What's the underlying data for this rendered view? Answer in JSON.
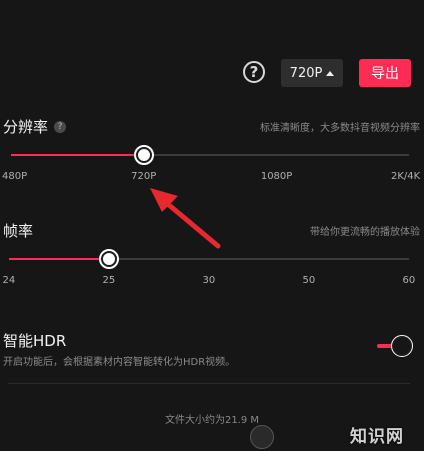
{
  "toolbar": {
    "help_symbol": "?",
    "resolution_selected": "720P",
    "export_label": "导出"
  },
  "resolution": {
    "title": "分辨率",
    "help_symbol": "?",
    "hint": "标准清晰度，大多数抖音视频分辨率",
    "ticks": [
      "480P",
      "720P",
      "1080P",
      "2K/4K"
    ],
    "selected_index": 1,
    "selected_value": "720P"
  },
  "framerate": {
    "title": "帧率",
    "hint": "带给你更流畅的播放体验",
    "ticks": [
      "24",
      "25",
      "30",
      "50",
      "60"
    ],
    "selected_index": 1,
    "selected_value": "25"
  },
  "hdr": {
    "title": "智能HDR",
    "description": "开启功能后，会根据素材内容智能转化为HDR视频。",
    "enabled": true
  },
  "footer": {
    "file_size": "文件大小约为21.9 M"
  },
  "watermark": {
    "text": "知识网"
  },
  "colors": {
    "accent": "#fe2c55",
    "background": "#161616"
  }
}
